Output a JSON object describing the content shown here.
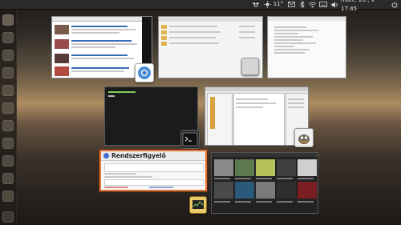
{
  "panel": {
    "temperature": "11°",
    "datetime": "márc. 20., v 17.45"
  },
  "launcher": {
    "items": [
      "dash",
      "files",
      "browser",
      "office",
      "terminal",
      "software-center",
      "settings",
      "trash"
    ]
  },
  "windows": {
    "system_monitor": {
      "title": "Rendszerfigyelő"
    }
  },
  "colors": {
    "accent": "#e0763a",
    "panel": "#2b2a28"
  }
}
